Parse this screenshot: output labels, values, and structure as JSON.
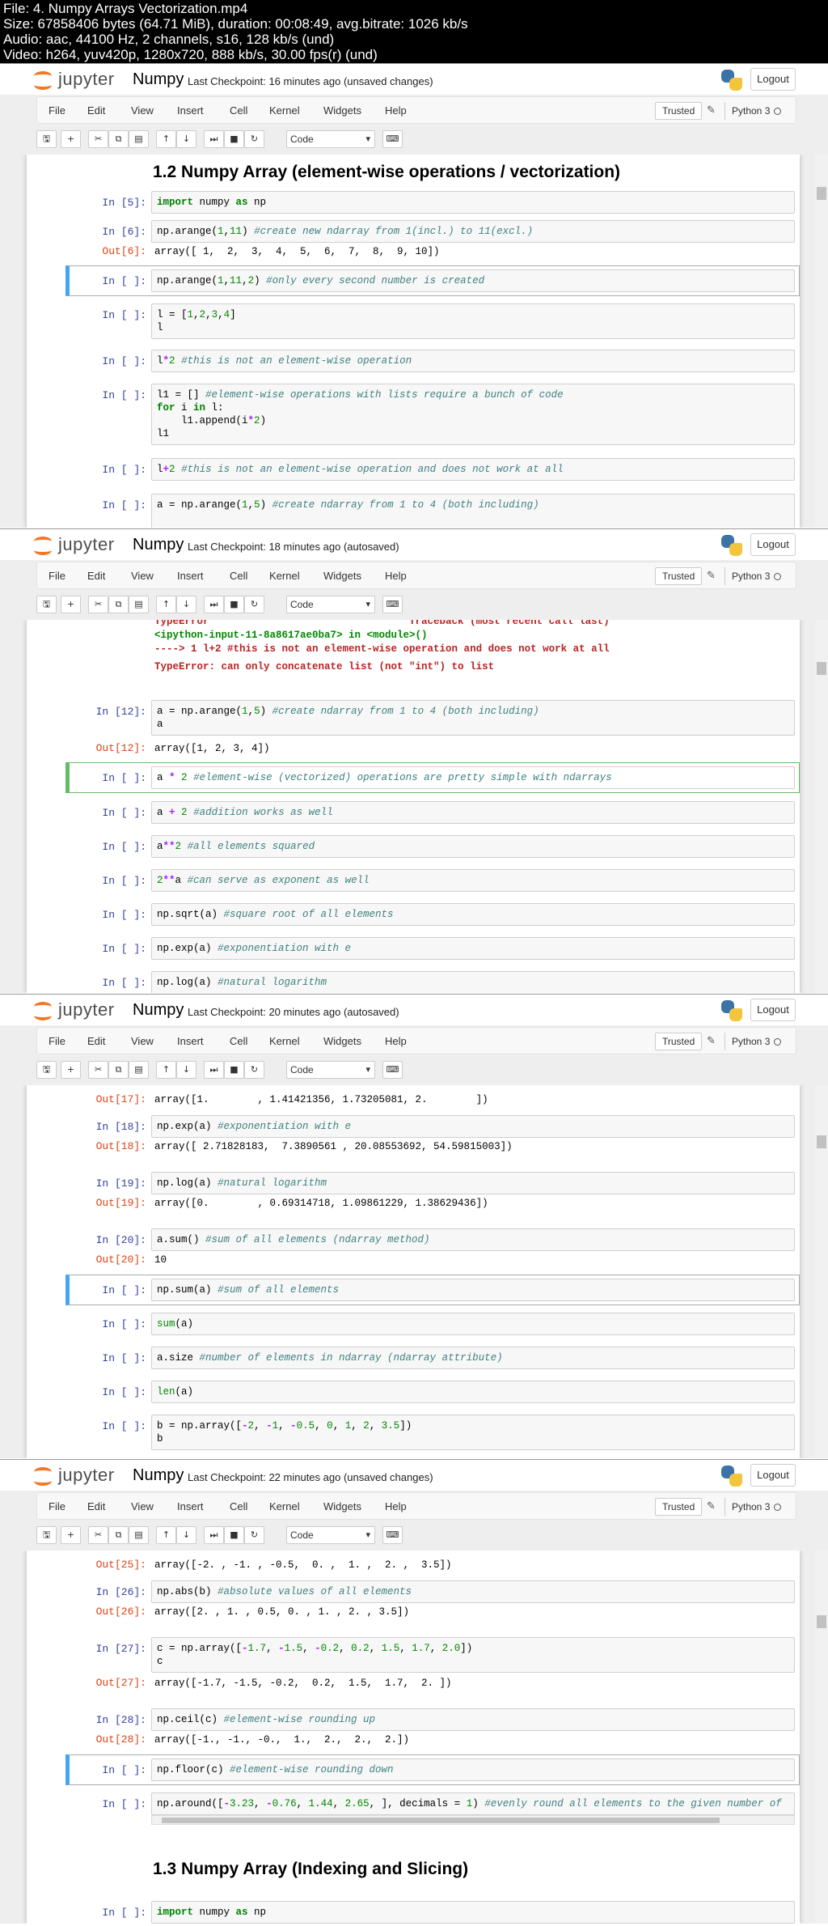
{
  "info": {
    "line1": "File: 4. Numpy Arrays Vectorization.mp4",
    "line2": "Size: 67858406 bytes (64.71 MiB), duration: 00:08:49, avg.bitrate: 1026 kb/s",
    "line3": "Audio: aac, 44100 Hz, 2 channels, s16, 128 kb/s (und)",
    "line4": "Video: h264, yuv420p, 1280x720, 888 kb/s, 30.00 fps(r) (und)"
  },
  "app": {
    "logo_text": "jupyter",
    "notebook_name": "Numpy",
    "logout": "Logout",
    "trusted": "Trusted",
    "kernel": "Python 3",
    "cell_type": "Code",
    "menu": [
      "File",
      "Edit",
      "View",
      "Insert",
      "Cell",
      "Kernel",
      "Widgets",
      "Help"
    ]
  },
  "frames": [
    {
      "checkpoint": "Last Checkpoint: 16 minutes ago (unsaved changes)"
    },
    {
      "checkpoint": "Last Checkpoint: 18 minutes ago (autosaved)"
    },
    {
      "checkpoint": "Last Checkpoint: 20 minutes ago (autosaved)"
    },
    {
      "checkpoint": "Last Checkpoint: 22 minutes ago (unsaved changes)"
    }
  ],
  "f1": {
    "heading": "1.2 Numpy Array (element-wise operations / vectorization)",
    "p5": "In [5]:",
    "p6": "In [6]:",
    "o6": "Out[6]:",
    "pe": "In [ ]:",
    "out6": "array([ 1,  2,  3,  4,  5,  6,  7,  8,  9, 10])"
  },
  "f2": {
    "err1": "TypeError                                 Traceback (most recent call last)",
    "err2": "<ipython-input-11-8a8617ae0ba7> in <module>()",
    "err3": "----> 1 l+2 #this is not an element-wise operation and does not work at all",
    "err4": "TypeError: can only concatenate list (not \"int\") to list",
    "p12": "In [12]:",
    "o12": "Out[12]:",
    "pe": "In [ ]:",
    "out12": "array([1, 2, 3, 4])"
  },
  "f3": {
    "o17": "Out[17]:",
    "p18": "In [18]:",
    "o18": "Out[18]:",
    "p19": "In [19]:",
    "o19": "Out[19]:",
    "p20": "In [20]:",
    "o20": "Out[20]:",
    "pe": "In [ ]:",
    "out17": "array([1.        , 1.41421356, 1.73205081, 2.        ])",
    "out18": "array([ 2.71828183,  7.3890561 , 20.08553692, 54.59815003])",
    "out19": "array([0.        , 0.69314718, 1.09861229, 1.38629436])",
    "out20": "10"
  },
  "f4": {
    "o25": "Out[25]:",
    "p26": "In [26]:",
    "o26": "Out[26]:",
    "p27": "In [27]:",
    "o27": "Out[27]:",
    "p28": "In [28]:",
    "o28": "Out[28]:",
    "pe": "In [ ]:",
    "out25": "array([-2. , -1. , -0.5,  0. ,  1. ,  2. ,  3.5])",
    "out26": "array([2. , 1. , 0.5, 0. , 1. , 2. , 3.5])",
    "out27": "array([-1.7, -1.5, -0.2,  0.2,  1.5,  1.7,  2. ])",
    "out28": "array([-1., -1., -0.,  1.,  2.,  2.,  2.])",
    "heading2": "1.3 Numpy Array (Indexing and Slicing)"
  }
}
